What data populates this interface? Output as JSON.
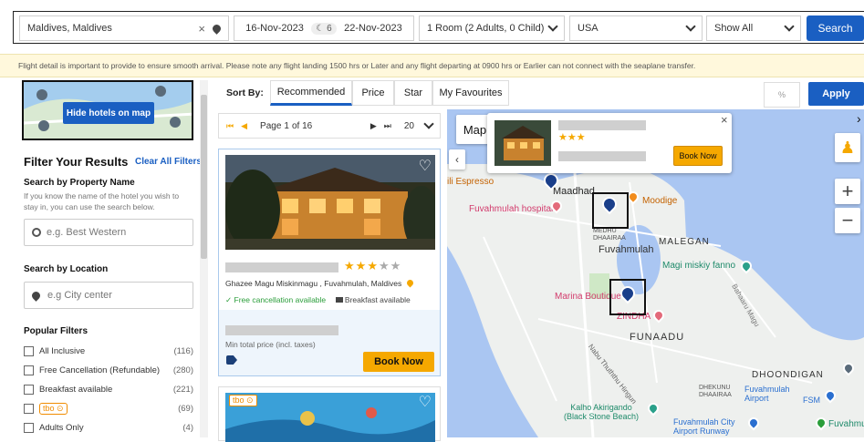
{
  "search": {
    "destination": "Maldives, Maldives",
    "checkin": "16-Nov-2023",
    "nights": "6",
    "checkout": "22-Nov-2023",
    "rooms": "1 Room (2 Adults, 0 Child)",
    "nationality": "USA",
    "show": "Show All",
    "search_label": "Search"
  },
  "notice": "Flight detail is important to provide to ensure smooth arrival. Please note any flight landing 1500 hrs or Later and any flight departing at 0900 hrs or Earlier can not connect with the seaplane transfer.",
  "sidebar": {
    "hide_map_label": "Hide hotels on map",
    "filter_title": "Filter Your Results",
    "clear_all": "Clear All Filters",
    "property_title": "Search by Property Name",
    "property_help": "If you know the name of the hotel you wish to stay in, you can use the search below.",
    "property_placeholder": "e.g. Best Western",
    "location_title": "Search by Location",
    "location_placeholder": "e.g City center",
    "popular_title": "Popular Filters",
    "filters": [
      {
        "label": "All Inclusive",
        "count": "(116)"
      },
      {
        "label": "Free Cancellation (Refundable)",
        "count": "(280)"
      },
      {
        "label": "Breakfast available",
        "count": "(221)"
      },
      {
        "label": "tbo",
        "count": "(69)"
      },
      {
        "label": "Adults Only",
        "count": "(4)"
      }
    ]
  },
  "sort": {
    "label": "Sort By:",
    "tabs": [
      "Recommended",
      "Price",
      "Star",
      "My Favourites"
    ],
    "percent_placeholder": "%",
    "apply_label": "Apply"
  },
  "pager": {
    "page_text": "Page",
    "current": "1",
    "of_text": "of 16",
    "per_page": "20"
  },
  "hotel": {
    "stars": 3,
    "max_stars": 5,
    "address": "Ghazee Magu Miskinmagu , Fuvahmulah, Maldives",
    "free_cancel": "Free cancellation available",
    "breakfast": "Breakfast available",
    "price_note": "Min total price (incl. taxes)",
    "book_label": "Book Now"
  },
  "hotel2": {
    "badge": "tbo"
  },
  "map": {
    "type_label": "Map",
    "popup_book_label": "Book Now",
    "popup_stars": 3,
    "places": {
      "espresso": "ili Espresso",
      "maadhad": "Maadhad",
      "moodige": "Moodige",
      "hospital": "Fuvahmulah hospital",
      "dhaairaa1": "MEDHU\nDHAAIRAA",
      "fuvahmulah": "Fuvahmulah",
      "malegan": "MALEGAN",
      "magi": "Magi miskiy fanno",
      "marina": "Marina Boutique",
      "zindha": "ZINDHA",
      "funaadu": "FUNAADU",
      "road": "Nabu Thuththu Hingun",
      "bahaaru": "Bahaaru Magu",
      "dhoondigan": "DHOONDIGAN",
      "dhekunu": "DHEKUNU\nDHAAIRAA",
      "airport": "Fuvahmulah\nAirport",
      "fsm": "FSM",
      "kalho": "Kalho Akirigando\n(Black Stone Beach)",
      "runway": "Fuvahmulah City\nAirport Runway",
      "fuvahmu": "Fuvahmu"
    }
  },
  "colors": {
    "primary": "#1a5fc2",
    "accent": "#f5a800",
    "map_water": "#aac6f2",
    "notice_bg": "#fff8dc"
  }
}
